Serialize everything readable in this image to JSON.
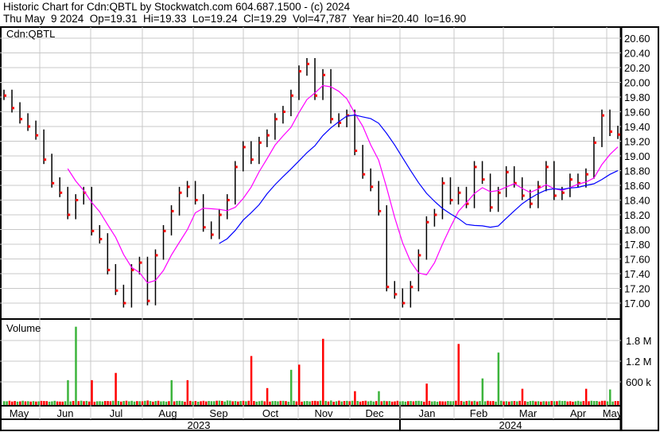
{
  "header": {
    "title": "Historic Chart for Cdn:QBTL by Stockwatch.com 604.687.1500 - (c) 2024",
    "quote": "Thu May  9 2024  Op=19.31  Hi=19.33  Lo=19.24  Cl=19.29  Vol=47,787  Year hi=20.40  lo=16.90"
  },
  "chart_data": [
    {
      "type": "line",
      "title": "Cdn:QBTL",
      "ylim": [
        16.85,
        20.75
      ],
      "y_ticks": [
        "20.60",
        "20.40",
        "20.20",
        "20.00",
        "19.80",
        "19.60",
        "19.40",
        "19.20",
        "19.00",
        "18.80",
        "18.60",
        "18.40",
        "18.20",
        "18.00",
        "17.80",
        "17.60",
        "17.40",
        "17.20",
        "17.00"
      ],
      "month_labels": [
        "May",
        "Jun",
        "Jul",
        "Aug",
        "Sep",
        "Oct",
        "Nov",
        "Dec",
        "Jan",
        "Feb",
        "Mar",
        "Apr",
        "May"
      ],
      "year_labels": [
        "2023",
        "2024"
      ],
      "grid": true,
      "colors": {
        "bar": "#000000",
        "close_tick": "#ff0000",
        "ma_short": "#ff00ff",
        "ma_long": "#0000ff"
      },
      "closes": [
        19.82,
        19.65,
        19.5,
        19.4,
        19.28,
        18.95,
        18.63,
        18.5,
        18.2,
        18.4,
        18.5,
        17.98,
        17.87,
        17.45,
        17.17,
        17.0,
        17.45,
        17.55,
        17.03,
        17.65,
        17.98,
        18.25,
        18.5,
        18.58,
        18.4,
        18.03,
        17.93,
        18.2,
        18.4,
        18.85,
        19.12,
        18.95,
        19.18,
        19.28,
        19.5,
        19.6,
        19.82,
        20.15,
        20.25,
        19.82,
        20.1,
        19.5,
        19.45,
        19.55,
        19.07,
        18.75,
        18.58,
        18.25,
        17.22,
        17.12,
        17.0,
        17.22,
        17.65,
        18.1,
        18.2,
        18.63,
        18.4,
        18.5,
        18.35,
        18.85,
        18.68,
        18.3,
        18.5,
        18.78,
        18.63,
        18.46,
        18.35,
        18.58,
        18.85,
        18.46,
        18.5,
        18.68,
        18.63,
        18.75,
        19.18,
        19.55,
        19.33,
        19.29
      ]
    },
    {
      "type": "bar",
      "title": "Volume",
      "y_ticks": [
        "1.8 M",
        "1.2 M",
        "600 k"
      ],
      "ylim": [
        0,
        2300
      ],
      "unit": "thousands",
      "values": [
        40,
        30,
        35,
        40,
        30,
        45,
        35,
        30,
        650,
        2200,
        40,
        650,
        40,
        45,
        860,
        45,
        50,
        40,
        60,
        45,
        40,
        650,
        50,
        650,
        45,
        50,
        40,
        55,
        60,
        45,
        50,
        1350,
        40,
        420,
        45,
        50,
        950,
        1100,
        45,
        50,
        1850,
        60,
        55,
        50,
        330,
        45,
        50,
        330,
        40,
        35,
        40,
        45,
        50,
        550,
        40,
        35,
        40,
        1700,
        45,
        50,
        700,
        40,
        1450,
        40,
        45,
        400,
        45,
        40,
        35,
        40,
        45,
        40,
        50,
        400,
        45,
        50,
        380,
        45
      ],
      "up": [
        1,
        0,
        0,
        1,
        0,
        0,
        1,
        0,
        1,
        1,
        0,
        0,
        1,
        0,
        0,
        1,
        1,
        1,
        0,
        1,
        1,
        1,
        1,
        0,
        0,
        0,
        1,
        1,
        1,
        1,
        0,
        0,
        1,
        0,
        1,
        1,
        1,
        0,
        1,
        0,
        0,
        1,
        0,
        1,
        0,
        0,
        1,
        1,
        0,
        0,
        1,
        1,
        1,
        0,
        1,
        0,
        1,
        0,
        0,
        1,
        1,
        0,
        1,
        1,
        0,
        0,
        1,
        1,
        0,
        1,
        1,
        0,
        1,
        0,
        1,
        0,
        1,
        0
      ]
    }
  ]
}
